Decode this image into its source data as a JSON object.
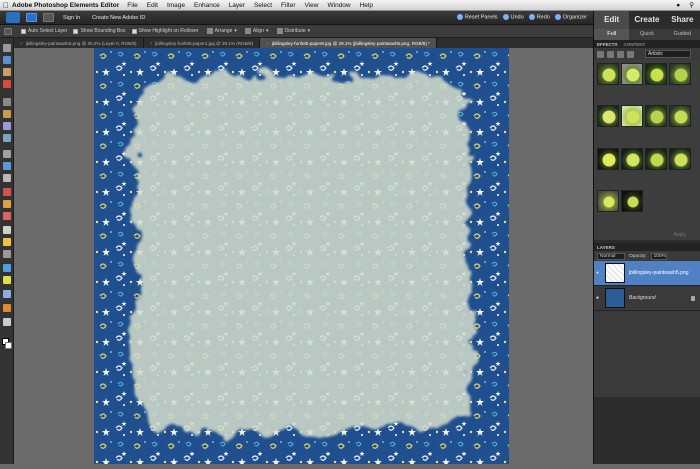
{
  "menubar": {
    "app_name": "Adobe Photoshop Elements Editor",
    "items": [
      "File",
      "Edit",
      "Image",
      "Enhance",
      "Layer",
      "Select",
      "Filter",
      "View",
      "Window",
      "Help"
    ]
  },
  "topbar": {
    "sign_in": "Sign In",
    "create_id": "Create New Adobe ID",
    "reset_panels": "Reset Panels",
    "undo": "Undo",
    "redo": "Redo",
    "organizer": "Organizer"
  },
  "options": {
    "auto_select": "Auto Select Layer",
    "bounding_box": "Show Bounding Box",
    "highlight": "Show Highlight on Rollover",
    "arrange": "Arrange",
    "align": "Align",
    "distribute": "Distribute"
  },
  "tabs": [
    {
      "label": "jbillingsley-paintwash5.png @ 30.2% (Layer 0, RGB/8)",
      "active": false
    },
    {
      "label": "jbillingsley-funfetti-paper1.jpg @ 29.1% (RGB/8)",
      "active": false
    },
    {
      "label": "jbillingsley-funfetti-paper8.jpg @ 29.1% (jbillingsley-paintwash5.png, RGB/8) *",
      "active": true
    }
  ],
  "panel": {
    "modes": [
      "Edit",
      "Create",
      "Share"
    ],
    "submodes": [
      "Full",
      "Quick",
      "Guided"
    ],
    "effects_tabs": [
      "EFFECTS",
      "CONTENT"
    ],
    "effects_filter": "Artistic",
    "apply_label": "Apply",
    "layers_title": "LAYERS",
    "blend_mode": "Normal",
    "opacity_label": "Opacity:",
    "opacity_value": "100%",
    "layers": [
      {
        "name": "jbillingsley-paintwash5.png",
        "selected": true
      },
      {
        "name": "Background",
        "selected": false,
        "locked": true
      }
    ]
  },
  "colors": {
    "paper_blue": "#1f4f8f",
    "wash": "#cfd8c5",
    "layer_selected": "#4f81c4"
  }
}
